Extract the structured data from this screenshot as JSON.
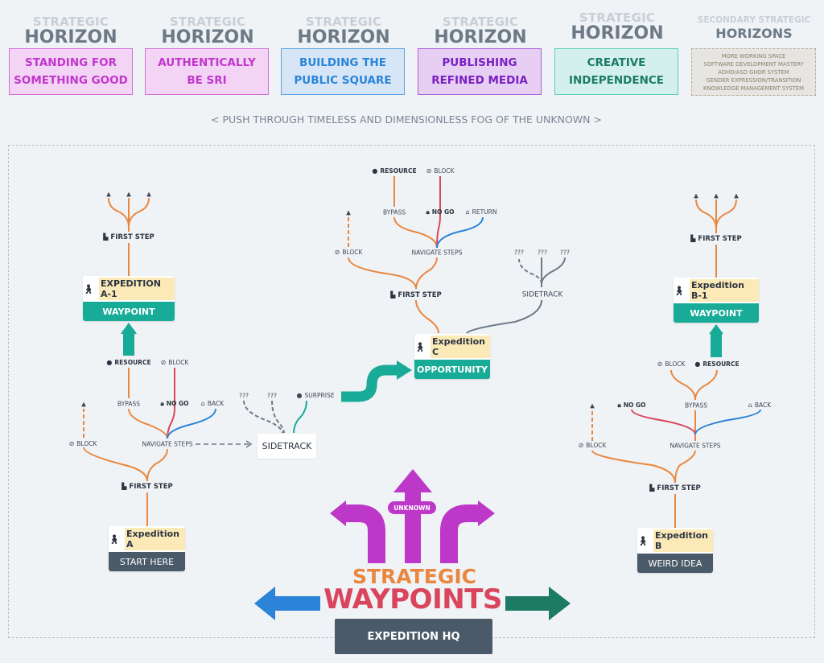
{
  "horizons": [
    {
      "small": "STRATEGIC",
      "big": "HORIZON",
      "label_line1": "STANDING FOR",
      "label_line2": "SOMETHING GOOD",
      "bg": "#f3d4f4",
      "border": "#cf6fd8",
      "text": "#c236cd"
    },
    {
      "small": "STRATEGIC",
      "big": "HORIZON",
      "label_line1": "AUTHENTICALLY",
      "label_line2": "BE SRI",
      "bg": "#f3d4f4",
      "border": "#cf6fd8",
      "text": "#c236cd"
    },
    {
      "small": "STRATEGIC",
      "big": "HORIZON",
      "label_line1": "BUILDING THE",
      "label_line2": "PUBLIC SQUARE",
      "bg": "#d6e6f7",
      "border": "#5aa0e0",
      "text": "#2b84d8"
    },
    {
      "small": "STRATEGIC",
      "big": "HORIZON",
      "label_line1": "PUBLISHING",
      "label_line2": "REFINED MEDIA",
      "bg": "#e6cff3",
      "border": "#a95fd8",
      "text": "#7a1fc4"
    },
    {
      "small": "STRATEGIC",
      "big": "HORIZON",
      "label_line1": "CREATIVE",
      "label_line2": "INDEPENDENCE",
      "bg": "#d3f0ec",
      "border": "#5fcbbb",
      "text": "#1b7b68"
    }
  ],
  "secondary": {
    "small": "SECONDARY STRATEGIC",
    "big": "HORIZONS",
    "items": [
      "MORE WORKING SPACE",
      "SOFTWARE DEVELOPMENT MASTERY",
      "ADHD/ASD GHDR SYSTEM",
      "GENDER EXPRESSION/TRANSITION",
      "KNOWLEDGE MANAGEMENT SYSTEM"
    ]
  },
  "subtitle": "< PUSH THROUGH TIMELESS AND DIMENSIONLESS FOG OF THE UNKNOWN >",
  "labels": {
    "first_step": "FIRST STEP",
    "navigate_steps": "NAVIGATE STEPS",
    "block": "BLOCK",
    "bypass": "BYPASS",
    "no_go": "NO GO",
    "back": "BACK",
    "return": "RETURN",
    "resource": "RESOURCE",
    "surprise": "SURPRISE",
    "unknown_q": "???",
    "sidetrack": "SIDETRACK"
  },
  "expeditions": {
    "a": {
      "name": "Expedition A",
      "tag": "START HERE"
    },
    "a1": {
      "name": "EXPEDITION A-1",
      "tag": "WAYPOINT"
    },
    "b": {
      "name": "Expedition B",
      "tag": "WEIRD IDEA"
    },
    "b1": {
      "name": "Expedition B-1",
      "tag": "WAYPOINT"
    },
    "c": {
      "name": "Expedition C",
      "tag": "OPPORTUNITY"
    }
  },
  "center": {
    "unknown": "UNKNOWN",
    "title_line1": "STRATEGIC",
    "title_line2": "WAYPOINTS",
    "hq": "EXPEDITION HQ"
  },
  "colors": {
    "orange": "#e9873f",
    "red": "#d9455d",
    "blue": "#2b84d8",
    "teal": "#17ab98",
    "gray": "#6c7a87",
    "purple": "#bd38c9",
    "dark_green": "#1d7a63"
  }
}
